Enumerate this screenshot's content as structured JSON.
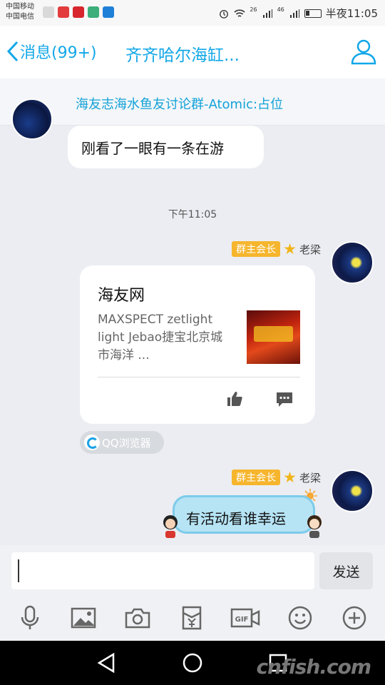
{
  "status_bar": {
    "carrier_1": "中国移动",
    "carrier_2": "中国电信",
    "network_1": "26",
    "network_2": "46",
    "time": "半夜11:05"
  },
  "header": {
    "back_label": "消息(99+)",
    "title": "齐齐哈尔海缸..."
  },
  "pinned": {
    "text": "海友志海水鱼友讨论群-Atomic:占位"
  },
  "messages": [
    {
      "type": "text",
      "side": "left",
      "text": "刚看了一眼有一条在游"
    },
    {
      "type": "timestamp",
      "text": "下午11:05"
    },
    {
      "type": "link_card",
      "side": "right",
      "sender_badge": "群主会长",
      "sender_name": "老梁",
      "card_title": "海友网",
      "card_description": "MAXSPECT zetlight light Jebao捷宝北京城市海洋 ...",
      "card_thumbnail": "promo-thumbnail",
      "source_label": "QQ浏览器"
    },
    {
      "type": "text",
      "side": "right",
      "sender_badge": "群主会长",
      "sender_name": "老梁",
      "text": "有活动看谁幸运"
    }
  ],
  "composer": {
    "input_value": "",
    "send_label": "发送"
  },
  "toolbar": {
    "icons": [
      "microphone-icon",
      "image-icon",
      "camera-icon",
      "red-packet-icon",
      "gif-icon",
      "emoji-icon",
      "plus-icon"
    ],
    "gif_label": "GIF"
  },
  "nav": {
    "watermark": "cnfish.com"
  },
  "colors": {
    "accent": "#12a7e8",
    "badge": "#f6b52d",
    "background": "#ebedf2",
    "bubble_blue": "#b6e4f5"
  }
}
